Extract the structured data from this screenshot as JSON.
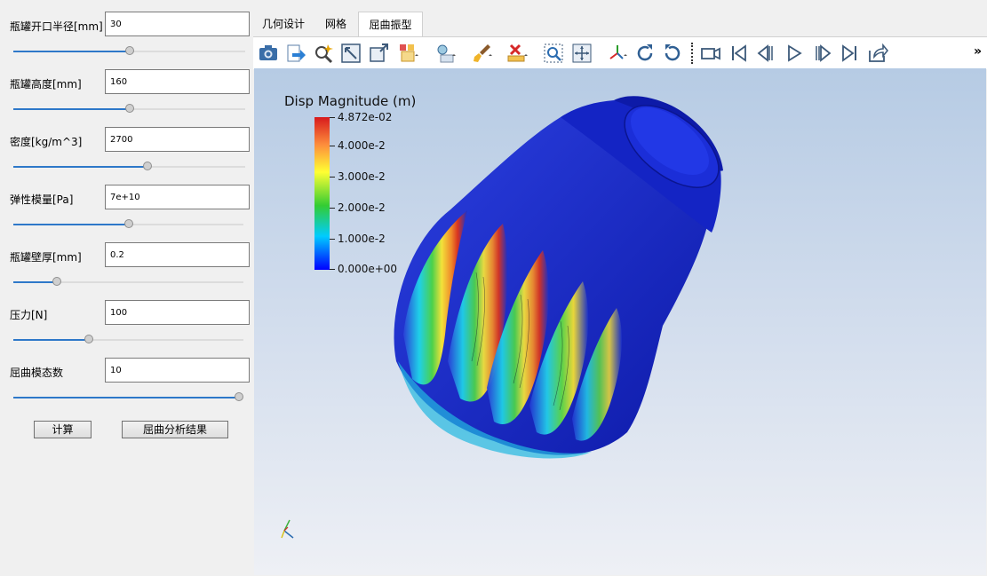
{
  "params": [
    {
      "label": "瓶罐开口半径[mm]",
      "value": "30",
      "slider": 0.5
    },
    {
      "label": "瓶罐高度[mm]",
      "value": "160",
      "slider": 0.5
    },
    {
      "label": "密度[kg/m^3]",
      "value": "2700",
      "slider": 0.58
    },
    {
      "label": "弹性模量[Pa]",
      "value": "7e+10",
      "slider": 0.5
    },
    {
      "label": "瓶罐壁厚[mm]",
      "value": "0.2",
      "slider": 0.19
    },
    {
      "label": "压力[N]",
      "value": "100",
      "slider": 0.33
    },
    {
      "label": "屈曲模态数",
      "value": "10",
      "slider": 1.0
    }
  ],
  "buttons": {
    "compute": "计算",
    "results": "屈曲分析结果"
  },
  "tabs": [
    "几何设计",
    "网格",
    "屈曲振型"
  ],
  "active_tab": "屈曲振型",
  "toolbar": {
    "icons": [
      "screenshot-icon",
      "export-icon",
      "zoom-select-icon",
      "fit-view-icon",
      "maximize-icon",
      "display-mode-icon",
      "light-icon",
      "brush-icon",
      "clear-icon",
      "zoom-region-icon",
      "center-icon",
      "axes-icon",
      "rotate-cw-icon",
      "rotate-ccw-icon",
      "camera-icon",
      "first-frame-icon",
      "prev-frame-icon",
      "play-icon",
      "next-frame-icon",
      "last-frame-icon",
      "export-animation-icon"
    ],
    "overflow": "»"
  },
  "legend": {
    "title": "Disp Magnitude (m)",
    "ticks": [
      "4.872e-02",
      "4.000e-2",
      "3.000e-2",
      "2.000e-2",
      "1.000e-2",
      "0.000e+00"
    ],
    "colors": [
      "#d7191c",
      "#fd8d3c",
      "#ffff33",
      "#33cc33",
      "#00ccff",
      "#0000ff"
    ]
  }
}
